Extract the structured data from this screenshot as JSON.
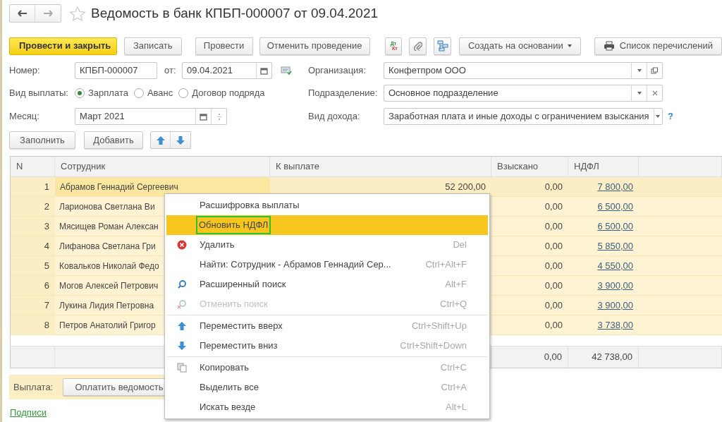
{
  "header": {
    "title": "Ведомость в банк КПБП-000007 от 09.04.2021"
  },
  "toolbar": [
    {
      "kind": "primary",
      "label": "Провести и закрыть"
    },
    {
      "kind": "button",
      "label": "Записать"
    },
    {
      "kind": "button",
      "label": "Провести"
    },
    {
      "kind": "button",
      "label": "Отменить проведение"
    },
    {
      "kind": "dtkt",
      "top": "Дт",
      "bottom": "Кт"
    },
    {
      "kind": "attach"
    },
    {
      "kind": "structure"
    },
    {
      "kind": "dropdown",
      "label": "Создать на основании"
    },
    {
      "kind": "print",
      "label": "Список перечислений"
    }
  ],
  "form": {
    "number": {
      "label": "Номер:",
      "value": "КПБП-000007"
    },
    "date": {
      "label": "от:",
      "value": "09.04.2021"
    },
    "organization": {
      "label": "Организация:",
      "value": "Конфетпром ООО"
    },
    "payment_type": {
      "label": "Вид выплаты:",
      "options": [
        {
          "label": "Зарплата",
          "selected": true
        },
        {
          "label": "Аванс",
          "selected": false
        },
        {
          "label": "Договор подряда",
          "selected": false
        }
      ]
    },
    "subdivision": {
      "label": "Подразделение:",
      "value": "Основное подразделение"
    },
    "month": {
      "label": "Месяц:",
      "value": "Март 2021"
    },
    "income_type": {
      "label": "Вид дохода:",
      "value": "Заработная плата и иные доходы с ограничением взыскания",
      "help": "?"
    }
  },
  "table_buttons": [
    "Заполнить",
    "Добавить"
  ],
  "table": {
    "columns": [
      "N",
      "Сотрудник",
      "К выплате",
      "Взыскано",
      "НДФЛ"
    ],
    "rows": [
      {
        "n": "1",
        "employee": "Абрамов Геннадий Сергеевич",
        "amount": "52 200,00",
        "recovered": "0,00",
        "ndfl": "7 800,00",
        "selected": true
      },
      {
        "n": "2",
        "employee": "Ларионова Светлана Ви",
        "recovered": "0,00",
        "ndfl": "6 500,00",
        "selected": false
      },
      {
        "n": "3",
        "employee": "Мясищев Роман Алексан",
        "recovered": "0,00",
        "ndfl": "6 500,00",
        "selected": false
      },
      {
        "n": "4",
        "employee": "Лифанова Светлана Гри",
        "recovered": "0,00",
        "ndfl": "5 850,00",
        "selected": false
      },
      {
        "n": "5",
        "employee": "Ковальков Николай Федо",
        "recovered": "0,00",
        "ndfl": "4 550,00",
        "selected": false
      },
      {
        "n": "6",
        "employee": "Могов Алексей Петрович",
        "recovered": "0,00",
        "ndfl": "3 900,00",
        "selected": false
      },
      {
        "n": "7",
        "employee": "Лукина Лидия Петровна",
        "recovered": "0,00",
        "ndfl": "3 900,00",
        "selected": false
      },
      {
        "n": "8",
        "employee": "Петров Анатолий Григор",
        "recovered": "0,00",
        "ndfl": "3 738,00",
        "selected": false
      }
    ],
    "footer": {
      "recovered": "0,00",
      "ndfl": "42 738,00"
    }
  },
  "payment": {
    "label": "Выплата:",
    "button": "Оплатить ведомость"
  },
  "link": "Подписи",
  "context_menu": [
    {
      "kind": "item",
      "label": "Расшифровка выплаты",
      "selected": false,
      "disabled": false
    },
    {
      "kind": "item",
      "label": "Обновить НДФЛ",
      "selected": true,
      "disabled": false
    },
    {
      "kind": "item",
      "label": "Удалить",
      "shortcut": "Del",
      "selected": false,
      "disabled": false
    },
    {
      "kind": "item",
      "label": "Найти: Сотрудник - Абрамов Геннадий Сер...",
      "shortcut": "Ctrl+Alt+F",
      "selected": false,
      "disabled": false
    },
    {
      "kind": "item",
      "label": "Расширенный поиск",
      "shortcut": "Alt+F",
      "selected": false,
      "disabled": false
    },
    {
      "kind": "item",
      "label": "Отменить поиск",
      "shortcut": "Ctrl+Q",
      "selected": false,
      "disabled": true
    },
    {
      "kind": "separator"
    },
    {
      "kind": "item",
      "label": "Переместить вверх",
      "shortcut": "Ctrl+Shift+Up",
      "selected": false,
      "disabled": false
    },
    {
      "kind": "item",
      "label": "Переместить вниз",
      "shortcut": "Ctrl+Shift+Down",
      "selected": false,
      "disabled": false
    },
    {
      "kind": "separator"
    },
    {
      "kind": "item",
      "label": "Копировать",
      "shortcut": "Ctrl+C",
      "selected": false,
      "disabled": false
    },
    {
      "kind": "item",
      "label": "Выделить все",
      "shortcut": "Ctrl+A",
      "selected": false,
      "disabled": false
    },
    {
      "kind": "item",
      "label": "Искать везде",
      "shortcut": "Alt+L",
      "selected": false,
      "disabled": false
    }
  ]
}
